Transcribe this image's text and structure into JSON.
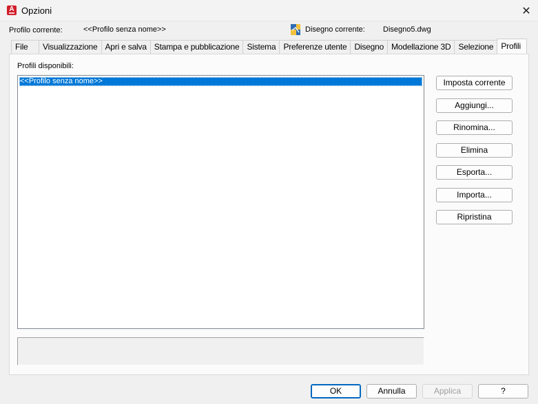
{
  "window": {
    "title": "Opzioni",
    "icon": "autocad-app-icon"
  },
  "header": {
    "current_profile_label": "Profilo corrente:",
    "current_profile_value": "<<Profilo senza nome>>",
    "current_drawing_label": "Disegno corrente:",
    "current_drawing_value": "Disegno5.dwg"
  },
  "tabs": [
    {
      "label": "File"
    },
    {
      "label": "Visualizzazione"
    },
    {
      "label": "Apri e salva"
    },
    {
      "label": "Stampa e pubblicazione"
    },
    {
      "label": "Sistema"
    },
    {
      "label": "Preferenze utente"
    },
    {
      "label": "Disegno"
    },
    {
      "label": "Modellazione 3D"
    },
    {
      "label": "Selezione"
    },
    {
      "label": "Profili"
    }
  ],
  "active_tab": "Profili",
  "profiles": {
    "label": "Profili disponibili:",
    "items": [
      "<<Profilo senza nome>>"
    ],
    "selected": "<<Profilo senza nome>>"
  },
  "side_buttons": {
    "set_current": "Imposta corrente",
    "add": "Aggiungi...",
    "rename": "Rinomina...",
    "delete": "Elimina",
    "export": "Esporta...",
    "import": "Importa...",
    "reset": "Ripristina"
  },
  "footer": {
    "ok": "OK",
    "cancel": "Annulla",
    "apply": "Applica",
    "help": "?"
  },
  "colors": {
    "selection": "#0078d7",
    "app_red": "#d21f2b"
  }
}
